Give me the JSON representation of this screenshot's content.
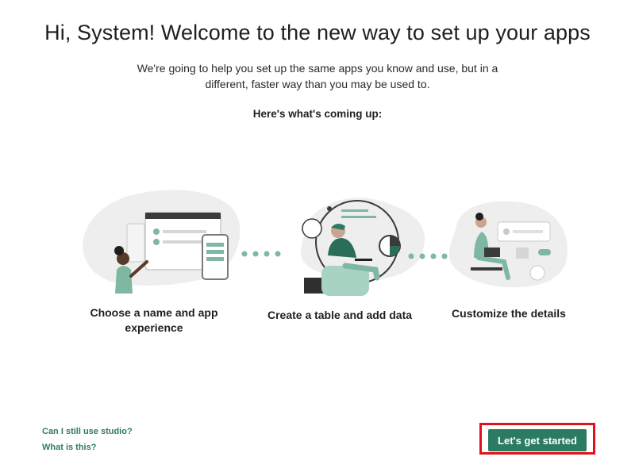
{
  "header": {
    "title": "Hi, System! Welcome to the new way to set up your apps",
    "intro": "We're going to help you set up the same apps you know and use, but in a different, faster way than you may be used to.",
    "coming_up": "Here's what's coming up:"
  },
  "steps": [
    {
      "label": "Choose a name and app experience",
      "icon": "devices-illustration"
    },
    {
      "label": "Create a table and add data",
      "icon": "data-illustration"
    },
    {
      "label": "Customize the details",
      "icon": "customize-illustration"
    }
  ],
  "links": {
    "studio": "Can I still use studio?",
    "what": "What is this?"
  },
  "cta": {
    "label": "Let's get started"
  },
  "colors": {
    "accent": "#2b7b63",
    "link": "#2e7d5b",
    "highlight": "#e0111b"
  }
}
